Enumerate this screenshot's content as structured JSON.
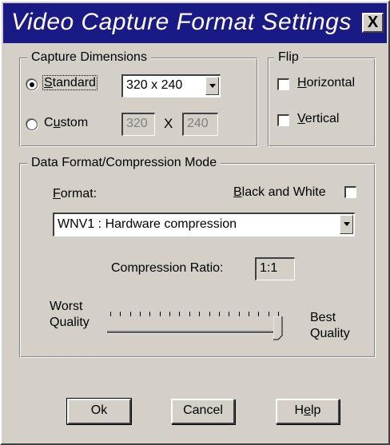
{
  "window": {
    "title": "Video Capture Format Settings",
    "close_label": "X"
  },
  "capture_dimensions": {
    "legend": "Capture Dimensions",
    "standard": {
      "label_before": "",
      "label_ul": "S",
      "label_after": "tandard",
      "selected": true
    },
    "custom": {
      "label_before": "C",
      "label_ul": "u",
      "label_after": "stom",
      "selected": false
    },
    "standard_value": "320 x 240",
    "custom_width": "320",
    "custom_separator": "X",
    "custom_height": "240"
  },
  "flip": {
    "legend": "Flip",
    "horizontal": {
      "label_ul": "H",
      "label_after": "orizontal",
      "checked": false
    },
    "vertical": {
      "label_ul": "V",
      "label_after": "ertical",
      "checked": false
    }
  },
  "data_format": {
    "legend": "Data Format/Compression Mode",
    "format_label_ul": "F",
    "format_label_after": "ormat:",
    "bw_label_ul": "B",
    "bw_label_after": "lack and White",
    "bw_checked": false,
    "format_value": "WNV1 : Hardware compression",
    "ratio_label": "Compression Ratio:",
    "ratio_value": "1:1",
    "worst_line1": "Worst",
    "worst_line2": "Quality",
    "best_line1": "Best",
    "best_line2": "Quality",
    "quality_level": 1.0,
    "tick_count": 18
  },
  "buttons": {
    "ok": "Ok",
    "cancel": "Cancel",
    "help_before": "H",
    "help_ul": "e",
    "help_after": "lp"
  }
}
